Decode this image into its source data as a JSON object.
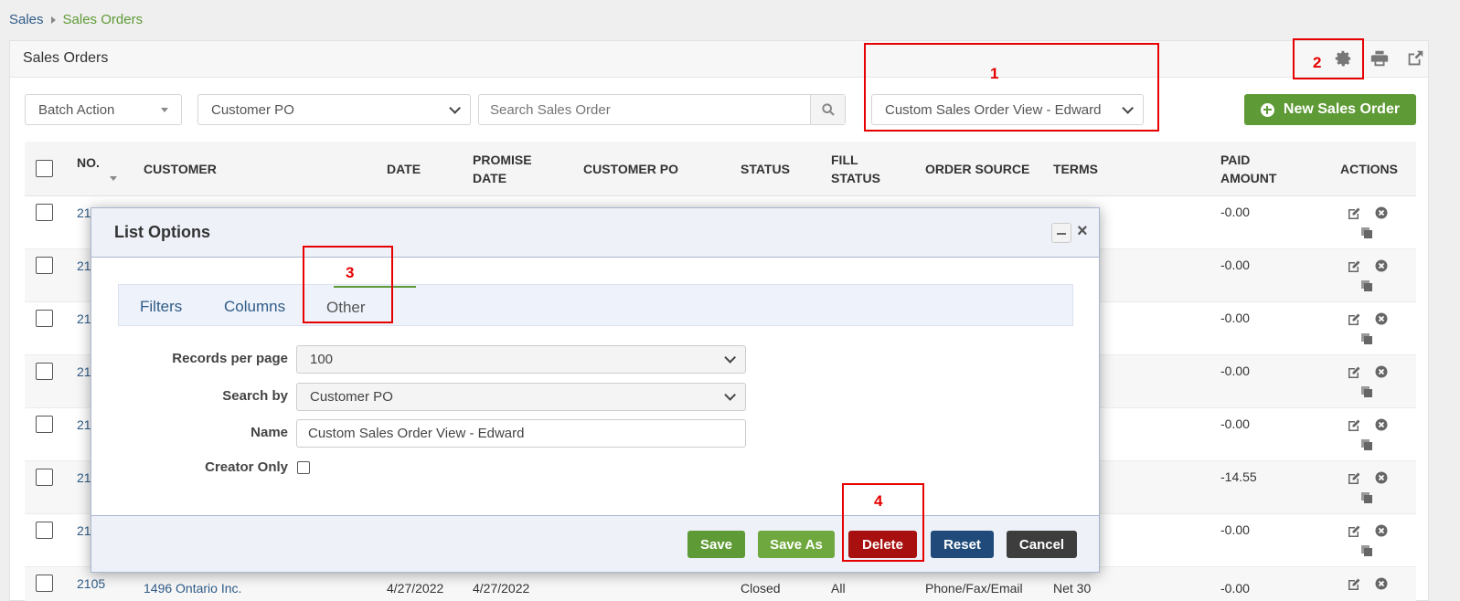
{
  "breadcrumb": {
    "root": "Sales",
    "current": "Sales Orders"
  },
  "panel": {
    "title": "Sales Orders"
  },
  "toolbar": {
    "batch_action": "Batch Action",
    "search_by": "Customer PO",
    "search_placeholder": "Search Sales Order",
    "view": "Custom Sales Order View - Edward",
    "new_button": "New Sales Order"
  },
  "table": {
    "headers": {
      "no": "NO.",
      "customer": "CUSTOMER",
      "date": "DATE",
      "promise_date_1": "PROMISE",
      "promise_date_2": "DATE",
      "customer_po": "CUSTOMER PO",
      "status": "STATUS",
      "fill_status_1": "FILL",
      "fill_status_2": "STATUS",
      "order_source": "ORDER SOURCE",
      "terms": "TERMS",
      "paid_amount_1": "PAID",
      "paid_amount_2": "AMOUNT",
      "actions": "ACTIONS"
    },
    "rows": [
      {
        "no": "21",
        "paid": "-0.00"
      },
      {
        "no": "21",
        "paid": "-0.00"
      },
      {
        "no": "21",
        "paid": "-0.00"
      },
      {
        "no": "21",
        "paid": "-0.00"
      },
      {
        "no": "21",
        "paid": "-0.00"
      },
      {
        "no": "21",
        "paid": "-14.55"
      },
      {
        "no": "21",
        "paid": "-0.00"
      },
      {
        "no": "2105",
        "customer": "1496 Ontario Inc.",
        "date": "4/27/2022",
        "promise": "4/27/2022",
        "status": "Closed",
        "fill": "All",
        "source": "Phone/Fax/Email",
        "terms": "Net 30",
        "paid": "-0.00"
      }
    ]
  },
  "modal": {
    "title": "List Options",
    "tabs": {
      "filters": "Filters",
      "columns": "Columns",
      "other": "Other"
    },
    "records_label": "Records per page",
    "records_value": "100",
    "searchby_label": "Search by",
    "searchby_value": "Customer PO",
    "name_label": "Name",
    "name_value": "Custom Sales Order View - Edward",
    "creator_label": "Creator Only",
    "buttons": {
      "save": "Save",
      "save_as": "Save As",
      "delete": "Delete",
      "reset": "Reset",
      "cancel": "Cancel"
    }
  },
  "annotations": {
    "a1": "1",
    "a2": "2",
    "a3": "3",
    "a4": "4"
  },
  "colors": {
    "accent_green": "#5e9a35",
    "link_blue": "#2f5b87",
    "delete_red": "#a80f0f",
    "reset_blue": "#1f4a7a",
    "cancel_dark": "#3d3d3d",
    "annotation_red": "#e60000"
  }
}
